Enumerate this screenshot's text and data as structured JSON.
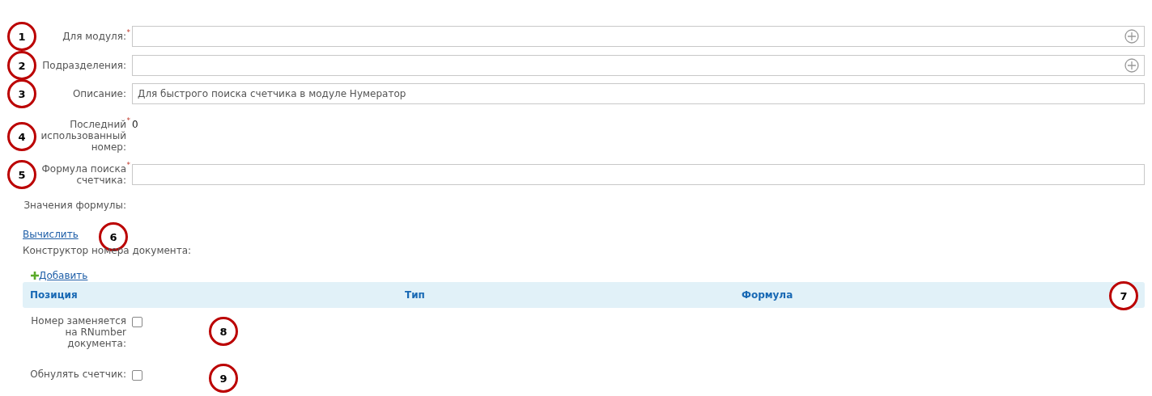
{
  "fields": [
    {
      "kind": "input",
      "label": "Для модуля:",
      "required_mark": "*",
      "add_button": true,
      "callout": "1"
    },
    {
      "kind": "input",
      "label": "Подразделения:",
      "add_button": true,
      "callout": "2"
    },
    {
      "kind": "input",
      "label": "Описание:",
      "value": "Для быстрого поиска счетчика в модуле Нумератор",
      "add_button": false,
      "callout": "3"
    },
    {
      "kind": "static",
      "label": "Последний использованный номер:",
      "required_mark": "*",
      "value": "0",
      "callout": "4"
    },
    {
      "kind": "input",
      "label": "Формула поиска счетчика:",
      "required_mark": "*",
      "add_button": false,
      "callout": "5"
    },
    {
      "kind": "static",
      "label": "Значения формулы:"
    }
  ],
  "compute_link": {
    "label": "Вычислить",
    "callout": "6"
  },
  "constructor": {
    "title": "Конструктор номера документа:",
    "add_link": "Добавить",
    "columns": [
      "Позиция",
      "Тип",
      "Формула"
    ],
    "callout": "7"
  },
  "checkboxes": [
    {
      "label": "Номер заменяется на RNumber документа:",
      "checked": false,
      "callout": "8"
    },
    {
      "label": "Обнулять счетчик:",
      "checked": false,
      "callout": "9"
    }
  ]
}
